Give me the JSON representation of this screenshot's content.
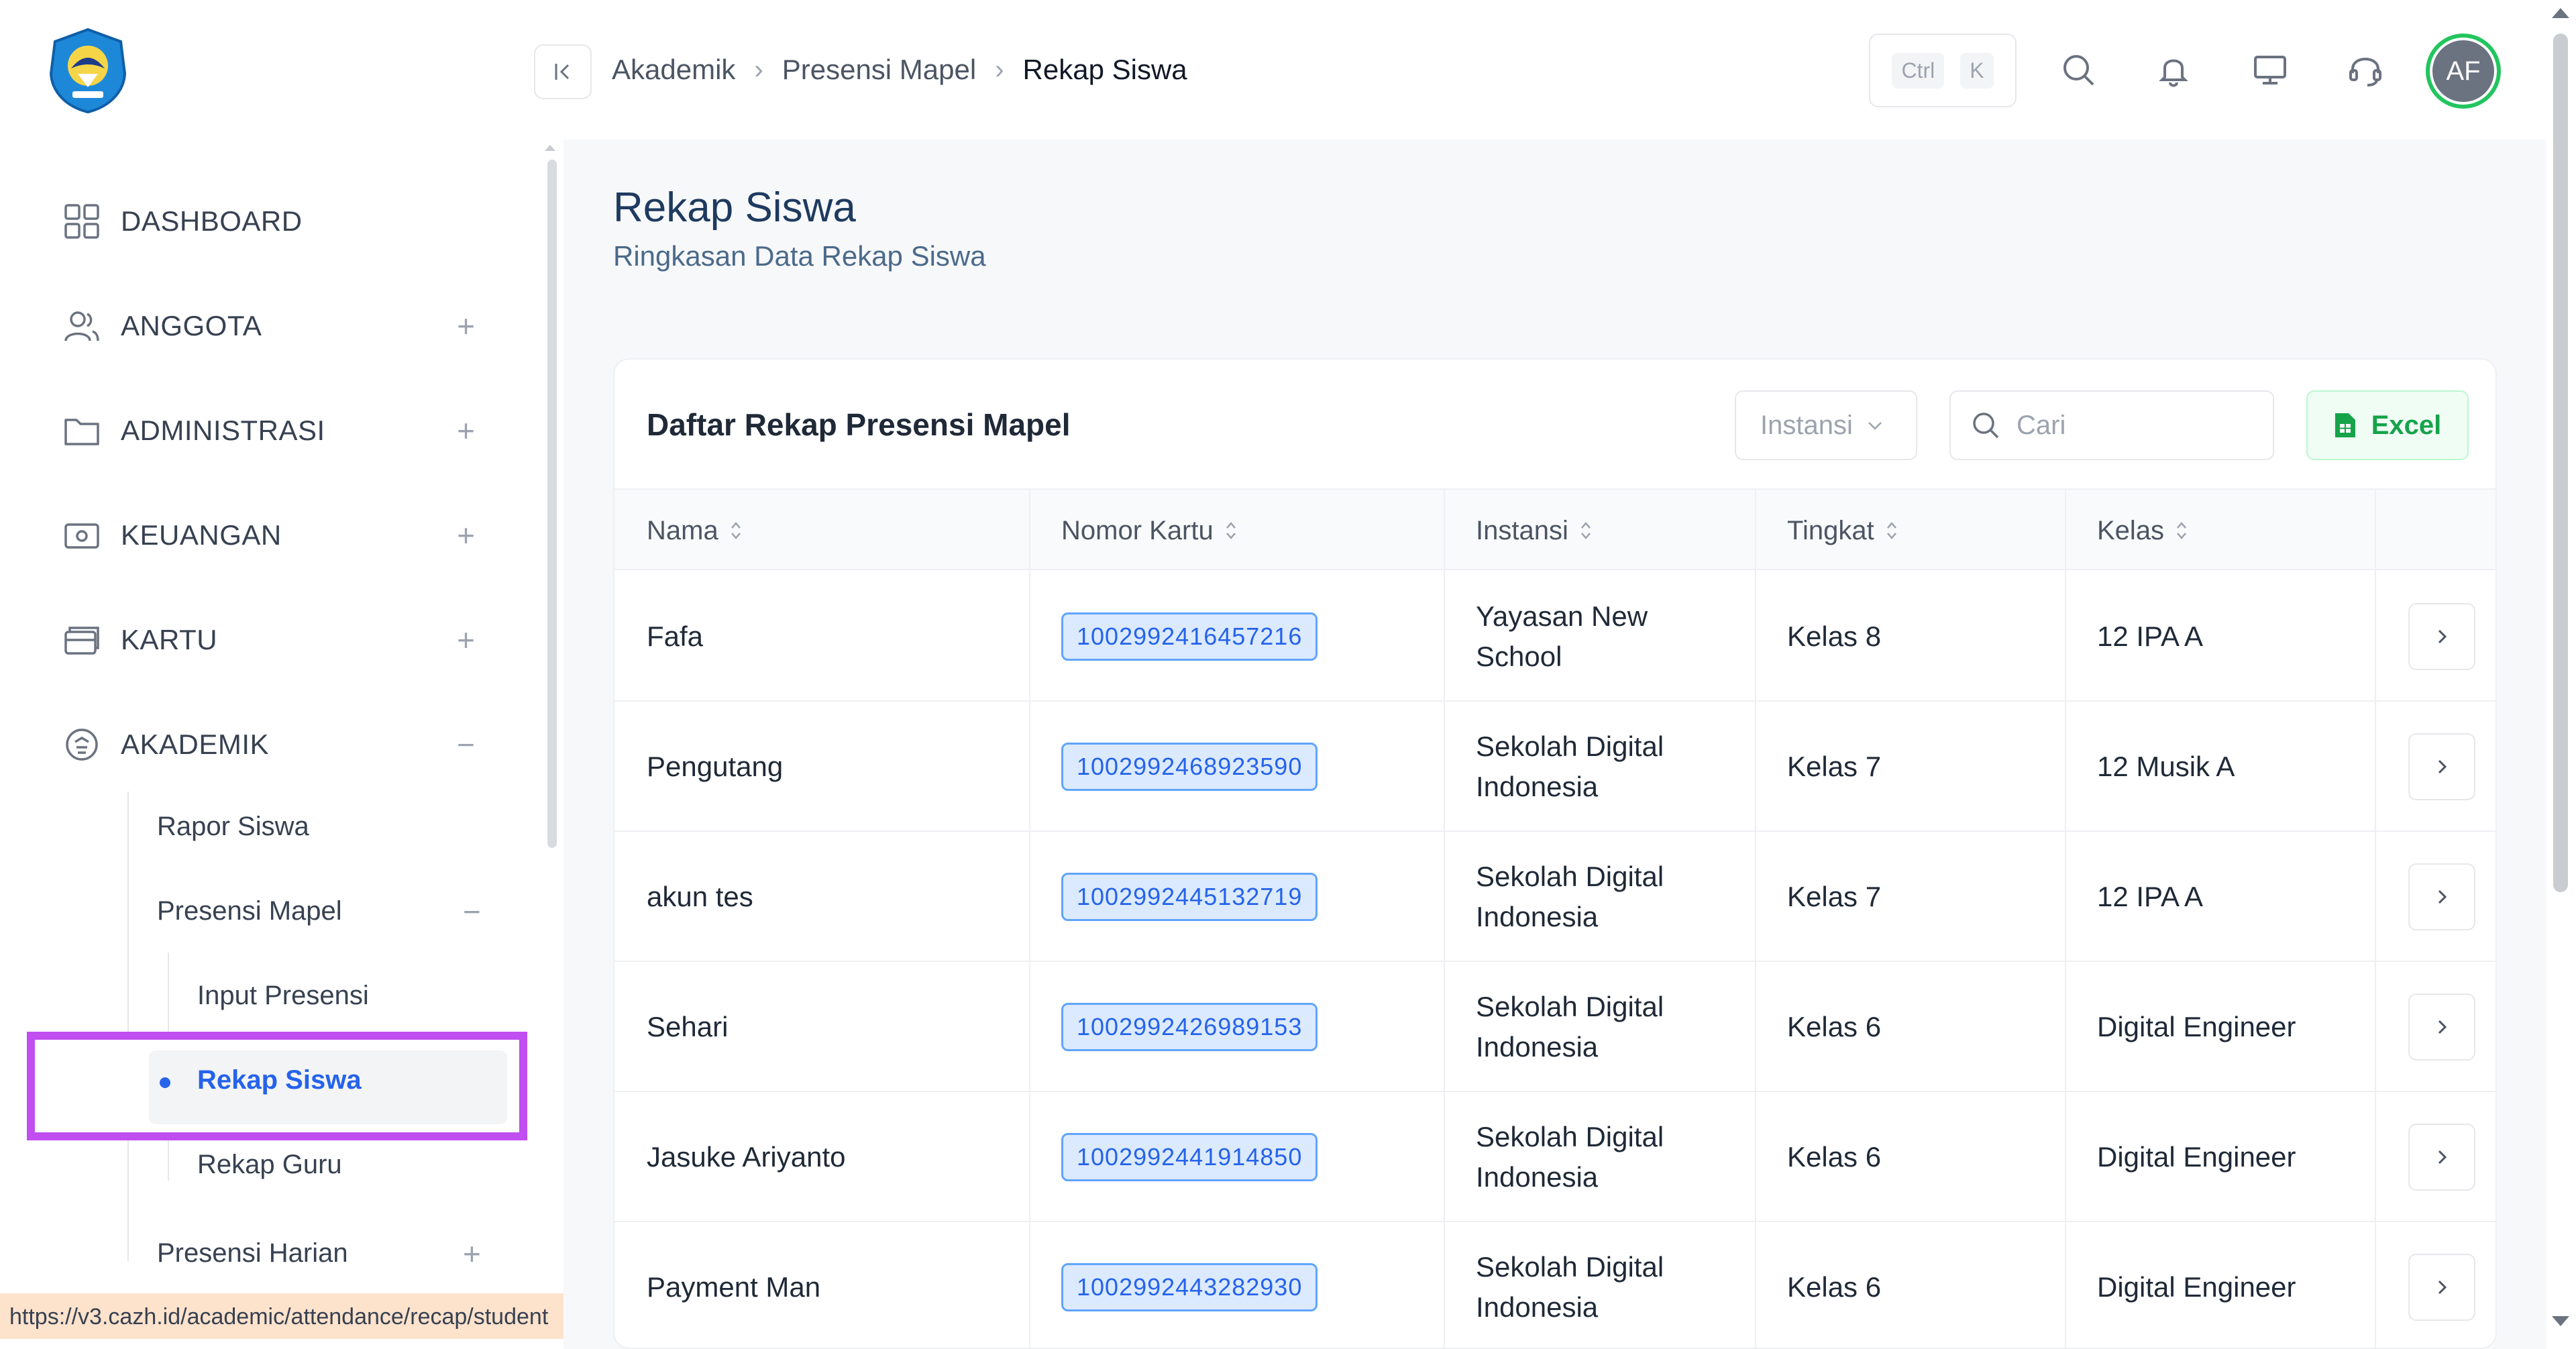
{
  "sidebar": {
    "logo_alt": "Tut Wuri Handayani",
    "items": [
      {
        "label": "DASHBOARD",
        "icon": "grid-icon",
        "toggle": ""
      },
      {
        "label": "ANGGOTA",
        "icon": "users-icon",
        "toggle": "+"
      },
      {
        "label": "ADMINISTRASI",
        "icon": "folder-icon",
        "toggle": "+"
      },
      {
        "label": "KEUANGAN",
        "icon": "cash-icon",
        "toggle": "+"
      },
      {
        "label": "KARTU",
        "icon": "card-icon",
        "toggle": "+"
      },
      {
        "label": "AKADEMIK",
        "icon": "academic-icon",
        "toggle": "−"
      }
    ],
    "akademik_sub": {
      "rapor": "Rapor Siswa",
      "presensi_mapel": "Presensi Mapel",
      "presensi_mapel_toggle": "−",
      "input_presensi": "Input Presensi",
      "rekap_siswa": "Rekap Siswa",
      "rekap_guru": "Rekap Guru",
      "presensi_harian": "Presensi Harian",
      "presensi_harian_toggle": "+"
    },
    "status_url": "https://v3.cazh.id/academic/attendance/recap/student"
  },
  "header": {
    "breadcrumb": [
      "Akademik",
      "Presensi Mapel",
      "Rekap Siswa"
    ],
    "shortcut": [
      "Ctrl",
      "K"
    ],
    "avatar_initials": "AF",
    "colors": {
      "accent": "#2563eb",
      "avatar_ring": "#22c55e",
      "highlight": "#c04ef0"
    }
  },
  "page": {
    "title": "Rekap Siswa",
    "subtitle": "Ringkasan Data Rekap Siswa"
  },
  "card": {
    "title": "Daftar Rekap Presensi Mapel",
    "instansi_placeholder": "Instansi",
    "search_placeholder": "Cari",
    "excel_label": "Excel",
    "columns": [
      "Nama",
      "Nomor Kartu",
      "Instansi",
      "Tingkat",
      "Kelas"
    ],
    "rows": [
      {
        "nama": "Fafa",
        "nomor": "1002992416457216",
        "instansi": "Yayasan New School",
        "tingkat": "Kelas 8",
        "kelas": "12 IPA A"
      },
      {
        "nama": "Pengutang",
        "nomor": "1002992468923590",
        "instansi": "Sekolah Digital Indonesia",
        "tingkat": "Kelas 7",
        "kelas": "12 Musik A"
      },
      {
        "nama": "akun tes",
        "nomor": "1002992445132719",
        "instansi": "Sekolah Digital Indonesia",
        "tingkat": "Kelas 7",
        "kelas": "12 IPA A"
      },
      {
        "nama": "Sehari",
        "nomor": "1002992426989153",
        "instansi": "Sekolah Digital Indonesia",
        "tingkat": "Kelas 6",
        "kelas": "Digital Engineer"
      },
      {
        "nama": "Jasuke Ariyanto",
        "nomor": "1002992441914850",
        "instansi": "Sekolah Digital Indonesia",
        "tingkat": "Kelas 6",
        "kelas": "Digital Engineer"
      },
      {
        "nama": "Payment Man",
        "nomor": "1002992443282930",
        "instansi": "Sekolah Digital Indonesia",
        "tingkat": "Kelas 6",
        "kelas": "Digital Engineer"
      }
    ]
  }
}
